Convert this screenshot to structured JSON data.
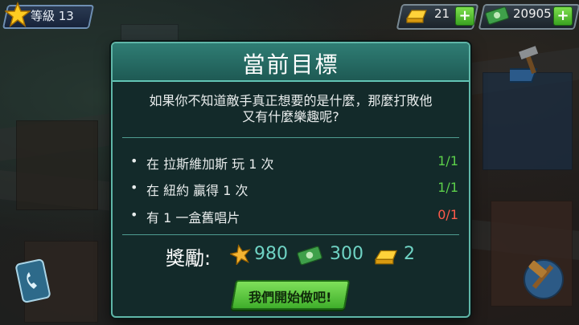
{
  "hud": {
    "level_label": "等級 13",
    "gold_count": "21",
    "cash_count": "20905",
    "plus_symbol": "+"
  },
  "dialog": {
    "title": "當前目標",
    "description_line1": "如果你不知道敵手真正想要的是什麼，那麼打敗他",
    "description_line2": "又有什麼樂趣呢?",
    "objectives": [
      {
        "text": "在 拉斯維加斯 玩 1 次",
        "progress": "1/1",
        "status": "done"
      },
      {
        "text": "在 紐約 贏得 1 次",
        "progress": "1/1",
        "status": "done"
      },
      {
        "text": "有 1 一盒舊唱片",
        "progress": "0/1",
        "status": "todo"
      }
    ],
    "reward_label": "獎勵:",
    "rewards": {
      "xp": "980",
      "cash": "300",
      "gold": "2"
    },
    "start_button": "我們開始做吧!"
  },
  "colors": {
    "accent": "#5fb6a8",
    "progress_done": "#5cd04a",
    "progress_todo": "#ff5a4a",
    "button_green": "#5cc63f"
  },
  "icons": {
    "level": "star-icon",
    "gold": "gold-bar-icon",
    "cash": "cash-bundle-icon",
    "phone": "phone-icon",
    "hammer": "hammer-icon"
  }
}
